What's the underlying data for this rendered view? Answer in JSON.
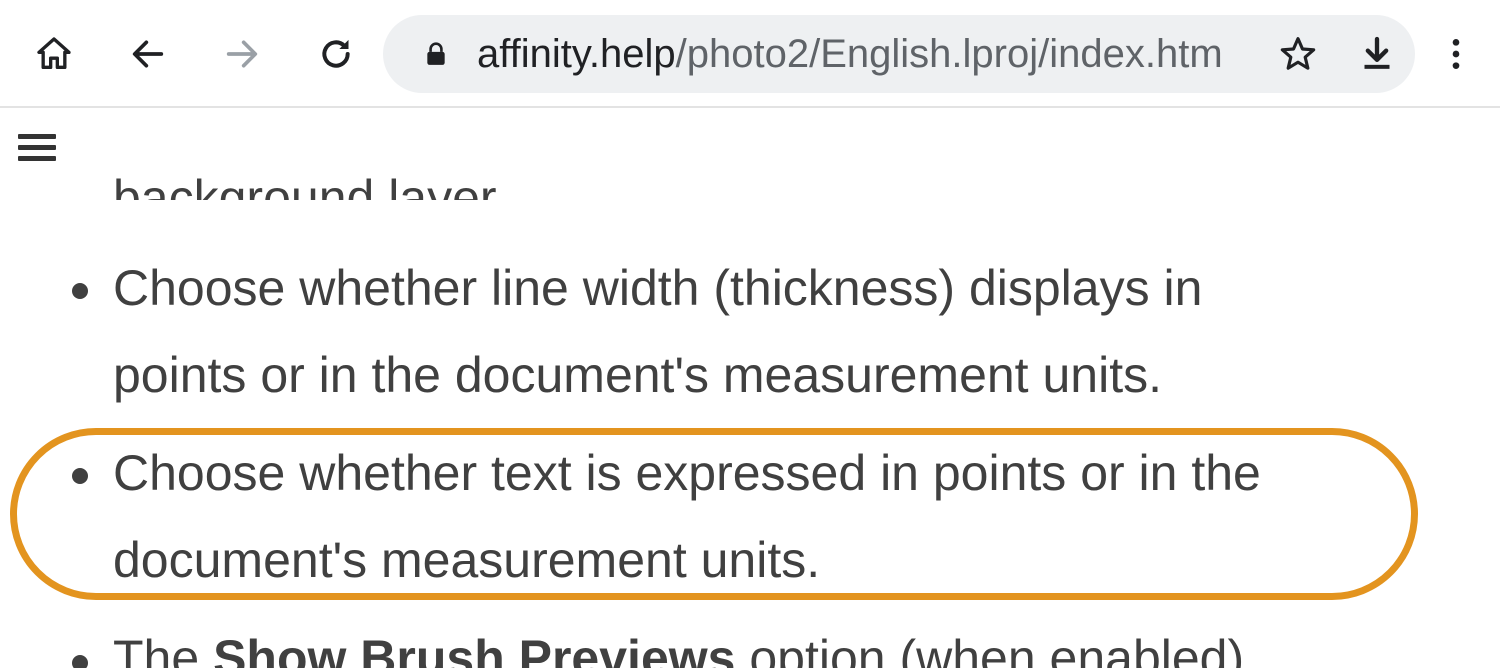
{
  "browser": {
    "url_domain": "affinity.help",
    "url_path": "/photo2/English.lproj/index.htm",
    "icons": [
      "home-icon",
      "back-icon",
      "forward-icon",
      "reload-icon",
      "lock-icon",
      "star-icon",
      "download-icon",
      "more-vert-icon"
    ]
  },
  "page": {
    "menu_icon": "hamburger-icon",
    "partial_top_line": "background layer.",
    "items": [
      {
        "line1": "Choose whether line width (thickness) displays in",
        "line2": "points or in the document's measurement units."
      },
      {
        "line1": "Choose whether text is expressed in points or in the",
        "line2": "document's measurement units."
      },
      {
        "prefix": "The ",
        "bold": "Show Brush Previews",
        "suffix": " option (when enabled)"
      }
    ]
  },
  "colors": {
    "highlight": "#e3941f",
    "omnibox_bg": "#eef0f2",
    "text": "#404040"
  }
}
